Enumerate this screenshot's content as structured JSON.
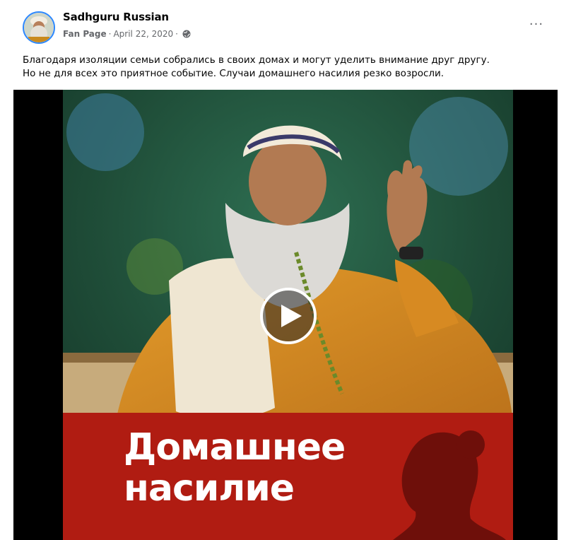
{
  "post": {
    "author": {
      "name": "Sadhguru Russian",
      "avatar_icon": "profile-photo"
    },
    "meta": {
      "page_type": "Fan Page",
      "separator": "·",
      "date": "April 22, 2020",
      "audience_icon": "globe-icon"
    },
    "more_label": "···",
    "text_lines": [
      "Благодаря изоляции семьи собрались в своих домах и могут уделить внимание друг другу.",
      "Но не для всех это приятное событие.  Случаи домашнего насилия резко возросли."
    ],
    "video": {
      "banner_lines": [
        "Домашнее",
        "насилие"
      ],
      "play_icon": "play-icon"
    }
  },
  "colors": {
    "banner_red": "#b01c12",
    "meta_gray": "#65676b",
    "avatar_ring": "#2d88ff",
    "video_background": "#000000"
  }
}
